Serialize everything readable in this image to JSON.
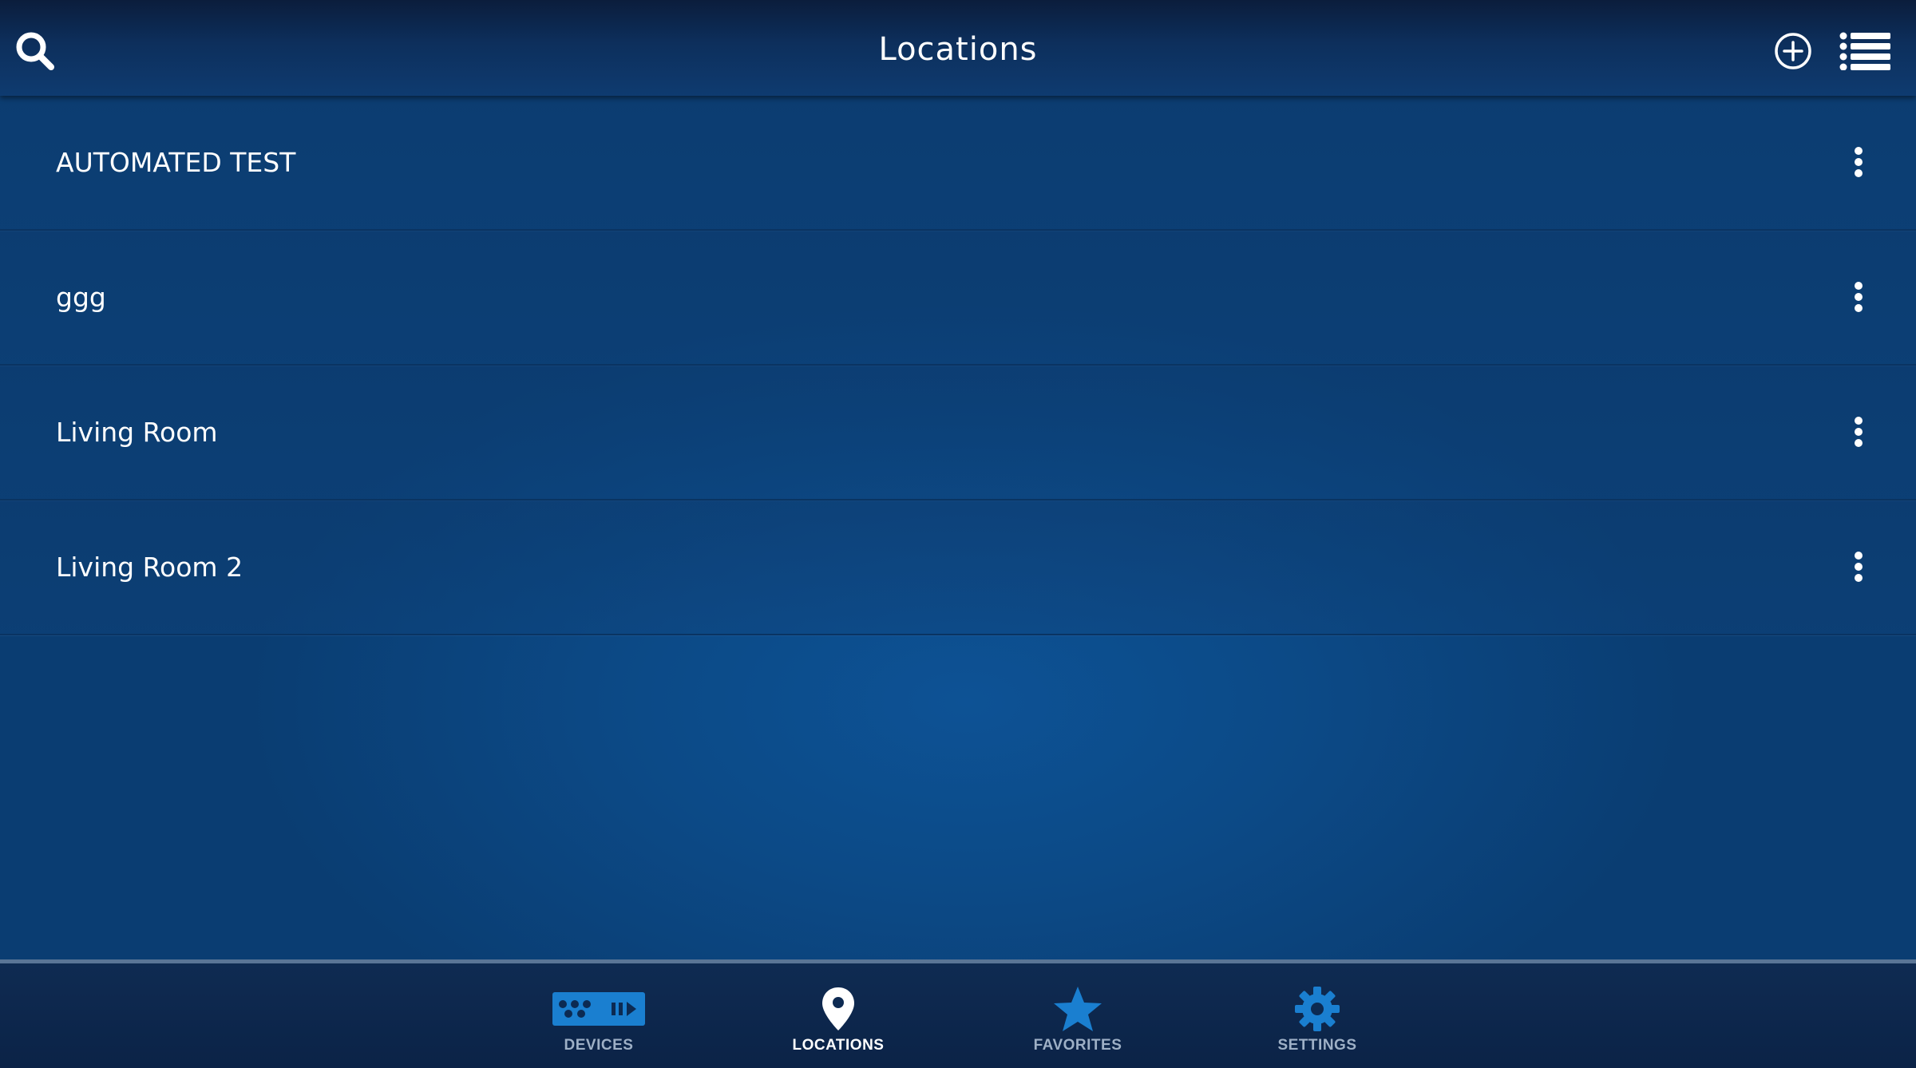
{
  "header": {
    "title": "Locations",
    "search_icon": "search-icon",
    "add_icon": "plus-circle-icon",
    "list_icon": "list-icon"
  },
  "locations": [
    {
      "name": "AUTOMATED TEST"
    },
    {
      "name": "ggg"
    },
    {
      "name": "Living Room"
    },
    {
      "name": "Living Room 2"
    }
  ],
  "tabs": [
    {
      "label": "DEVICES",
      "icon": "remote-device-icon",
      "active": false
    },
    {
      "label": "LOCATIONS",
      "icon": "location-pin-icon",
      "active": true
    },
    {
      "label": "FAVORITES",
      "icon": "star-icon",
      "active": false
    },
    {
      "label": "SETTINGS",
      "icon": "gear-icon",
      "active": false
    }
  ],
  "colors": {
    "background": "#0c4a87",
    "header": "#0e3b70",
    "tab_icon_inactive": "#1a7fd0",
    "tab_label_inactive": "#9eb0c6",
    "active": "#ffffff"
  }
}
